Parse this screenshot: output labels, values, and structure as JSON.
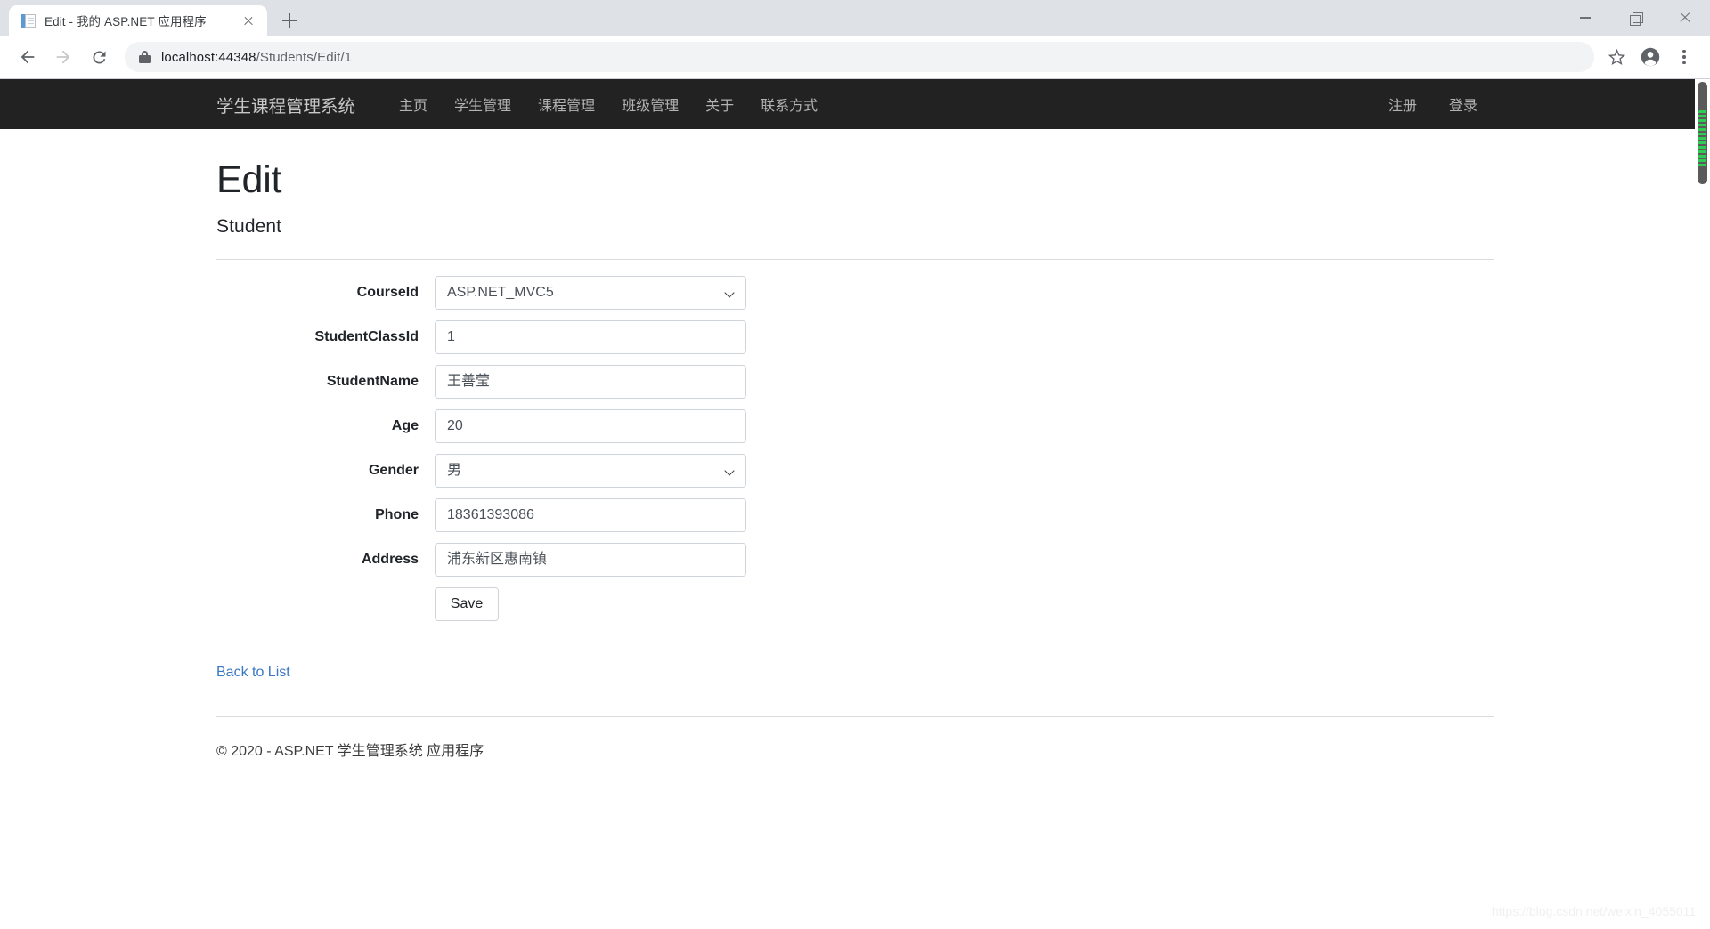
{
  "browser": {
    "tab": {
      "title": "Edit - 我的 ASP.NET 应用程序",
      "favicon": "document-icon",
      "close_icon": "close-icon"
    },
    "new_tab_icon": "plus-icon",
    "window_controls": {
      "minimize": "minimize-icon",
      "maximize": "restore-icon",
      "close": "close-icon"
    },
    "toolbar": {
      "back_icon": "back-arrow-icon",
      "forward_icon": "forward-arrow-icon",
      "reload_icon": "reload-icon",
      "lock_icon": "lock-icon",
      "url_host": "localhost:44348",
      "url_path": "/Students/Edit/1",
      "url_full": "localhost:44348/Students/Edit/1",
      "star_icon": "star-icon",
      "avatar_icon": "profile-avatar-icon",
      "menu_icon": "three-dot-menu-icon"
    }
  },
  "site": {
    "brand": "学生课程管理系统",
    "nav_links": [
      {
        "label": "主页"
      },
      {
        "label": "学生管理"
      },
      {
        "label": "课程管理"
      },
      {
        "label": "班级管理"
      },
      {
        "label": "关于"
      },
      {
        "label": "联系方式"
      }
    ],
    "nav_right": [
      {
        "label": "注册"
      },
      {
        "label": "登录"
      }
    ]
  },
  "page": {
    "title": "Edit",
    "subtitle": "Student",
    "form": {
      "fields": [
        {
          "label": "CourseId",
          "type": "select",
          "value": "ASP.NET_MVC5",
          "caret": "chevron-down-icon"
        },
        {
          "label": "StudentClassId",
          "type": "text",
          "value": "1"
        },
        {
          "label": "StudentName",
          "type": "text",
          "value": "王善莹"
        },
        {
          "label": "Age",
          "type": "text",
          "value": "20"
        },
        {
          "label": "Gender",
          "type": "select",
          "value": "男",
          "caret": "chevron-down-icon"
        },
        {
          "label": "Phone",
          "type": "text",
          "value": "18361393086"
        },
        {
          "label": "Address",
          "type": "text",
          "value": "浦东新区惠南镇"
        }
      ],
      "save_label": "Save"
    },
    "back_link": "Back to List",
    "footer": "© 2020 - ASP.NET 学生管理系统 应用程序",
    "watermark": "https://blog.csdn.net/weixin_40550118"
  },
  "colors": {
    "navbar_bg": "#222222",
    "link": "#3a77c2",
    "tab_bg": "#ffffff",
    "chrome_bg": "#dee1e6",
    "scrollbar_thumb": "#5a5a5a",
    "scrollbar_highlight": "#2ecc55"
  }
}
